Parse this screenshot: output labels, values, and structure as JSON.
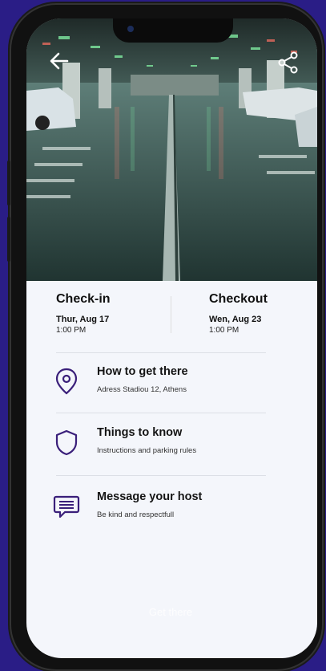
{
  "checkin": {
    "title": "Check-in",
    "day": "Thur, Aug 17",
    "time": "1:00 PM"
  },
  "checkout": {
    "title": "Checkout",
    "day": "Wen, Aug 23",
    "time": "1:00 PM"
  },
  "sections": [
    {
      "title": "How to get there",
      "subtitle": "Adress Stadiou 12, Athens",
      "icon": "location-pin-icon"
    },
    {
      "title": "Things to know",
      "subtitle": "Instructions and parking rules",
      "icon": "shield-icon"
    },
    {
      "title": "Message your host",
      "subtitle": "Be kind and respectfull",
      "icon": "message-icon"
    }
  ],
  "cta_label": "Get there",
  "colors": {
    "accent": "#3a1f7a",
    "background": "#2a1d86",
    "sheet": "#f4f6fb"
  }
}
